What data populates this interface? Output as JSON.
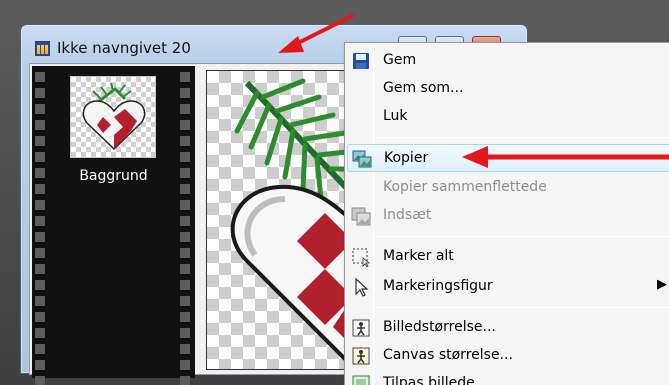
{
  "window": {
    "title": "Ikke navngivet 20"
  },
  "layers": {
    "name": "Baggrund"
  },
  "context_menu": {
    "items": [
      {
        "label": "Gem",
        "icon": "save-icon",
        "enabled": true
      },
      {
        "label": "Gem som...",
        "icon": "",
        "enabled": true
      },
      {
        "label": "Luk",
        "icon": "",
        "enabled": true
      },
      {
        "label": "Kopier",
        "icon": "copy-icon",
        "enabled": true,
        "highlighted": true
      },
      {
        "label": "Kopier sammenflettede",
        "icon": "",
        "enabled": false
      },
      {
        "label": "Indsæt",
        "icon": "paste-icon",
        "enabled": false
      },
      {
        "label": "Marker alt",
        "icon": "select-all-icon",
        "enabled": true
      },
      {
        "label": "Markeringsfigur",
        "icon": "pointer-icon",
        "enabled": true,
        "submenu": true
      },
      {
        "label": "Billedstørrelse...",
        "icon": "image-size-icon",
        "enabled": true
      },
      {
        "label": "Canvas størrelse...",
        "icon": "canvas-size-icon",
        "enabled": true
      },
      {
        "label": "Tilpas billede",
        "icon": "fit-image-icon",
        "enabled": true
      }
    ],
    "submenu_arrow": "▶"
  },
  "colors": {
    "annotation_arrow": "#e3161c",
    "heart_red": "#b3202d",
    "leaf_green": "#2e8b2e",
    "menu_highlight": "#dcf0fb"
  }
}
